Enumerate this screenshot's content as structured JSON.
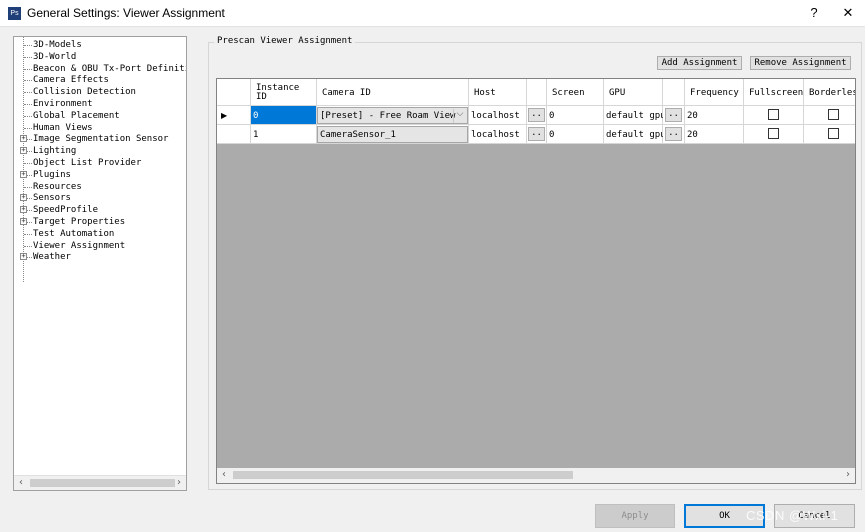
{
  "window": {
    "title": "General Settings: Viewer Assignment",
    "app_icon": "Ps",
    "help_label": "?",
    "close_label": "✕"
  },
  "tree": {
    "items": [
      {
        "label": "3D-Models",
        "expandable": false
      },
      {
        "label": "3D-World",
        "expandable": false
      },
      {
        "label": "Beacon & OBU Tx-Port Definitio",
        "expandable": false
      },
      {
        "label": "Camera Effects",
        "expandable": false
      },
      {
        "label": "Collision Detection",
        "expandable": false
      },
      {
        "label": "Environment",
        "expandable": false
      },
      {
        "label": "Global Placement",
        "expandable": false
      },
      {
        "label": "Human Views",
        "expandable": false
      },
      {
        "label": "Image Segmentation Sensor",
        "expandable": true
      },
      {
        "label": "Lighting",
        "expandable": true
      },
      {
        "label": "Object List Provider",
        "expandable": false
      },
      {
        "label": "Plugins",
        "expandable": true
      },
      {
        "label": "Resources",
        "expandable": false
      },
      {
        "label": "Sensors",
        "expandable": true
      },
      {
        "label": "SpeedProfile",
        "expandable": true
      },
      {
        "label": "Target Properties",
        "expandable": true
      },
      {
        "label": "Test Automation",
        "expandable": false
      },
      {
        "label": "Viewer Assignment",
        "expandable": false
      },
      {
        "label": "Weather",
        "expandable": true
      }
    ],
    "scroll_left": "‹",
    "scroll_right": "›"
  },
  "panel": {
    "group_title": "Prescan Viewer Assignment",
    "add_button": "Add Assignment",
    "remove_button": "Remove Assignment"
  },
  "grid": {
    "headers": {
      "instance_id": "Instance\nID",
      "camera_id": "Camera ID",
      "host": "Host",
      "screen": "Screen",
      "gpu": "GPU",
      "frequency": "Frequency",
      "fullscreen": "Fullscreen",
      "borderless": "Borderless"
    },
    "rows": [
      {
        "instance_id": "0",
        "camera_id": "[Preset] - Free Roam View",
        "host": "localhost",
        "screen": "0",
        "gpu": "default gpu",
        "frequency": "20",
        "fullscreen": false,
        "borderless": false,
        "current": true
      },
      {
        "instance_id": "1",
        "camera_id": "CameraSensor_1",
        "host": "localhost",
        "screen": "0",
        "gpu": "default gpu",
        "frequency": "20",
        "fullscreen": false,
        "borderless": false,
        "current": false
      }
    ],
    "row_indicator": "▶",
    "dots_label": "..",
    "combo_arrow": "⌵",
    "scroll_left": "‹",
    "scroll_right": "›"
  },
  "footer": {
    "apply_label": "Apply",
    "ok_label": "OK",
    "cancel_label": "Cancel"
  },
  "watermark": "CSDN @Wxi-1"
}
